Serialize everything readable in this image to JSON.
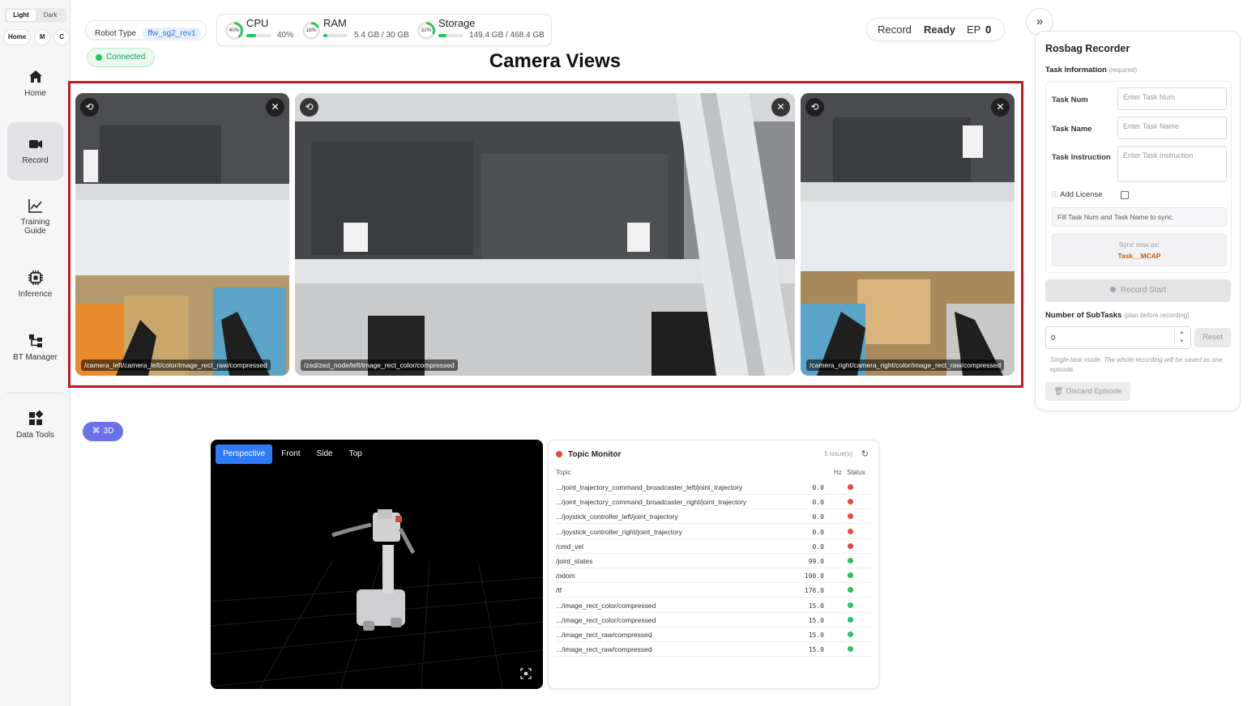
{
  "sidebar": {
    "theme": {
      "light": "Light",
      "dark": "Dark"
    },
    "quick": [
      "Home",
      "M",
      "C"
    ],
    "items": [
      {
        "label": "Home",
        "icon": "home-icon"
      },
      {
        "label": "Record",
        "icon": "video-camera-icon",
        "active": true
      },
      {
        "label": "Training Guide",
        "icon": "line-chart-icon"
      },
      {
        "label": "Inference",
        "icon": "chip-icon"
      },
      {
        "label": "BT Manager",
        "icon": "tree-icon"
      },
      {
        "label": "Data Tools",
        "icon": "grid-icon"
      }
    ]
  },
  "header": {
    "robot_type_label": "Robot Type",
    "robot_type_value": "ffw_sg2_rev1",
    "connection": "Connected",
    "resources": {
      "cpu": {
        "title": "CPU",
        "percent_label": "40%",
        "value": "40%",
        "fraction": 0.4
      },
      "ram": {
        "title": "RAM",
        "percent_label": "18%",
        "value": "5.4 GB / 30 GB",
        "fraction": 0.18
      },
      "storage": {
        "title": "Storage",
        "percent_label": "32%",
        "value": "149.4 GB / 468.4 GB",
        "fraction": 0.32
      }
    },
    "record_status": {
      "mode": "Record",
      "state": "Ready",
      "ep_label": "EP",
      "ep_value": "0"
    }
  },
  "camera": {
    "title": "Camera Views",
    "feeds": [
      {
        "topic": "/camera_left/camera_left/color/image_rect_raw/compressed"
      },
      {
        "topic": "/zed/zed_node/left/image_rect_color/compressed"
      },
      {
        "topic": "/camera_right/camera_right/color/image_rect_raw/compressed"
      }
    ]
  },
  "viewer": {
    "toggle_3d": "3D",
    "tabs": [
      "Perspective",
      "Front",
      "Side",
      "Top"
    ]
  },
  "topic_monitor": {
    "title": "Topic Monitor",
    "issues": "5 issue(s)",
    "columns": {
      "topic": "Topic",
      "hz": "Hz",
      "status": "Status"
    },
    "rows": [
      {
        "topic": ".../joint_trajectory_command_broadcaster_left/joint_trajectory",
        "hz": "0.0",
        "status": "error"
      },
      {
        "topic": ".../joint_trajectory_command_broadcaster_right/joint_trajectory",
        "hz": "0.0",
        "status": "error"
      },
      {
        "topic": ".../joystick_controller_left/joint_trajectory",
        "hz": "0.0",
        "status": "error"
      },
      {
        "topic": ".../joystick_controller_right/joint_trajectory",
        "hz": "0.0",
        "status": "error"
      },
      {
        "topic": "/cmd_vel",
        "hz": "0.0",
        "status": "error"
      },
      {
        "topic": "/joint_states",
        "hz": "99.0",
        "status": "ok"
      },
      {
        "topic": "/odom",
        "hz": "100.0",
        "status": "ok"
      },
      {
        "topic": "/tf",
        "hz": "176.0",
        "status": "ok"
      },
      {
        "topic": ".../image_rect_color/compressed",
        "hz": "15.0",
        "status": "ok"
      },
      {
        "topic": ".../image_rect_color/compressed",
        "hz": "15.0",
        "status": "ok"
      },
      {
        "topic": ".../image_rect_raw/compressed",
        "hz": "15.0",
        "status": "ok"
      },
      {
        "topic": ".../image_rect_raw/compressed",
        "hz": "15.0",
        "status": "ok"
      }
    ],
    "status_colors": {
      "error": "#ef4444",
      "ok": "#22c55e"
    }
  },
  "recorder": {
    "title": "Rosbag Recorder",
    "task_info_label": "Task Information",
    "task_info_note": "(required)",
    "task_num_label": "Task Num",
    "task_num_placeholder": "Enter Task Num",
    "task_name_label": "Task Name",
    "task_name_placeholder": "Enter Task Name",
    "task_instruction_label": "Task Instruction",
    "task_instruction_placeholder": "Enter Task Instruction",
    "add_license_label": "Add License",
    "sync_hint": "Fill Task Num and Task Name to sync.",
    "sync_now_label": "Sync now as:",
    "sync_name": "Task__MCAP",
    "record_start": "Record Start",
    "subtasks_label": "Number of SubTasks",
    "subtasks_note": "(plan before recording)",
    "subtasks_value": "0",
    "reset_label": "Reset",
    "mode_note": "Single-task mode. The whole recording will be saved as one episode.",
    "discard_label": "Discard Episode"
  }
}
